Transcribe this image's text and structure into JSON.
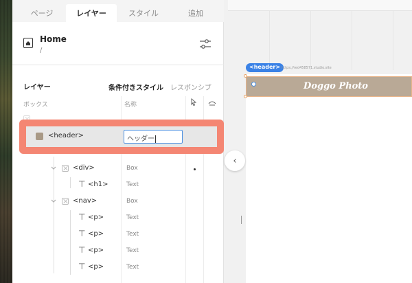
{
  "tabs": [
    {
      "label": "ページ"
    },
    {
      "label": "レイヤー"
    },
    {
      "label": "スタイル"
    },
    {
      "label": "追加"
    }
  ],
  "page": {
    "title": "Home",
    "path": "/"
  },
  "layers_panel": {
    "heading": "レイヤー",
    "mode_conditional": "条件付きスタイル",
    "mode_responsive": "レスポンシブ",
    "col_box": "ボックス",
    "col_name": "名称"
  },
  "selected": {
    "label": "<header>",
    "rename_value": "ヘッダー"
  },
  "rows": [
    {
      "label": "<div>",
      "type": "Box"
    },
    {
      "label": "<h1>",
      "type": "Text"
    },
    {
      "label": "<nav>",
      "type": "Box"
    },
    {
      "label": "<p>",
      "type": "Text"
    },
    {
      "label": "<p>",
      "type": "Text"
    },
    {
      "label": "<p>",
      "type": "Text"
    },
    {
      "label": "<p>",
      "type": "Text"
    }
  ],
  "canvas": {
    "header_tag": "<header>",
    "site_url": "https://red458571.studio.site",
    "site_title": "Doggo Photo"
  },
  "colors": {
    "highlight": "#f48673",
    "accent": "#3b82e6",
    "site_header": "#b9a996"
  }
}
